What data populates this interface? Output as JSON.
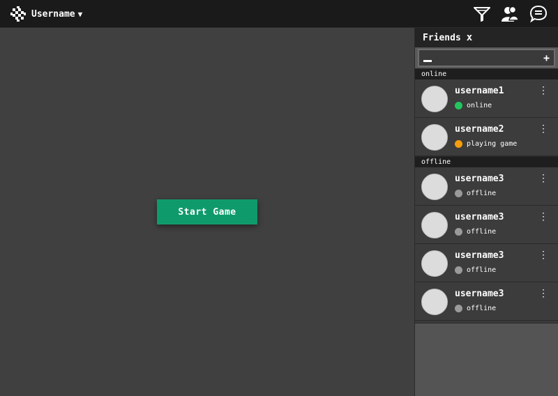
{
  "topbar": {
    "username_label": "Username",
    "caret": "▼",
    "icons": [
      "filter-icon",
      "friends-icon",
      "chat-icon"
    ]
  },
  "main": {
    "start_button_label": "Start Game"
  },
  "friends_panel": {
    "title": "Friends",
    "close_glyph": "x",
    "plus_glyph": "+",
    "sections": [
      {
        "label": "online",
        "friends": [
          {
            "name": "username1",
            "status": "online",
            "status_color": "#22c55e"
          },
          {
            "name": "username2",
            "status": "playing game",
            "status_color": "#f59e0b"
          }
        ]
      },
      {
        "label": "offline",
        "friends": [
          {
            "name": "username3",
            "status": "offline",
            "status_color": "#9a9a9a"
          },
          {
            "name": "username3",
            "status": "offline",
            "status_color": "#9a9a9a"
          },
          {
            "name": "username3",
            "status": "offline",
            "status_color": "#9a9a9a"
          },
          {
            "name": "username3",
            "status": "offline",
            "status_color": "#9a9a9a"
          }
        ]
      }
    ]
  },
  "colors": {
    "start_button": "#0f9a6c",
    "topbar": "#1a1a1a",
    "main_bg": "#404040"
  }
}
